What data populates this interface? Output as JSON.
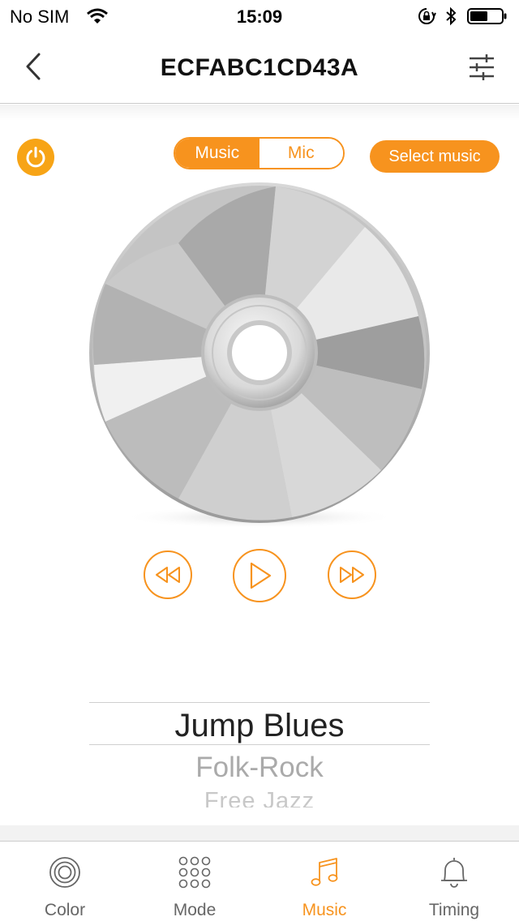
{
  "status_bar": {
    "carrier": "No SIM",
    "time": "15:09",
    "icons": [
      "wifi-icon",
      "orientation-lock-icon",
      "bluetooth-icon",
      "battery-icon"
    ]
  },
  "nav": {
    "title": "ECFABC1CD43A",
    "back_icon": "chevron-left-icon",
    "settings_icon": "sliders-icon"
  },
  "controls": {
    "power_icon": "power-icon",
    "source_tabs": [
      {
        "label": "Music",
        "selected": true
      },
      {
        "label": "Mic",
        "selected": false
      }
    ],
    "select_music_label": "Select music"
  },
  "playback": {
    "buttons": [
      "rewind-icon",
      "play-icon",
      "fast-forward-icon"
    ]
  },
  "genre_picker": {
    "items": [
      "Jump Blues",
      "Folk-Rock",
      "Free Jazz"
    ],
    "selected": "Jump Blues"
  },
  "tab_bar": {
    "tabs": [
      {
        "label": "Color",
        "icon": "color-rings-icon",
        "active": false
      },
      {
        "label": "Mode",
        "icon": "grid-dots-icon",
        "active": false
      },
      {
        "label": "Music",
        "icon": "music-note-icon",
        "active": true
      },
      {
        "label": "Timing",
        "icon": "bell-icon",
        "active": false
      }
    ]
  },
  "colors": {
    "accent": "#f7931e",
    "power": "#f7a416",
    "text_primary": "#222222",
    "text_muted": "#aaaaaa",
    "tab_inactive": "#666666"
  }
}
